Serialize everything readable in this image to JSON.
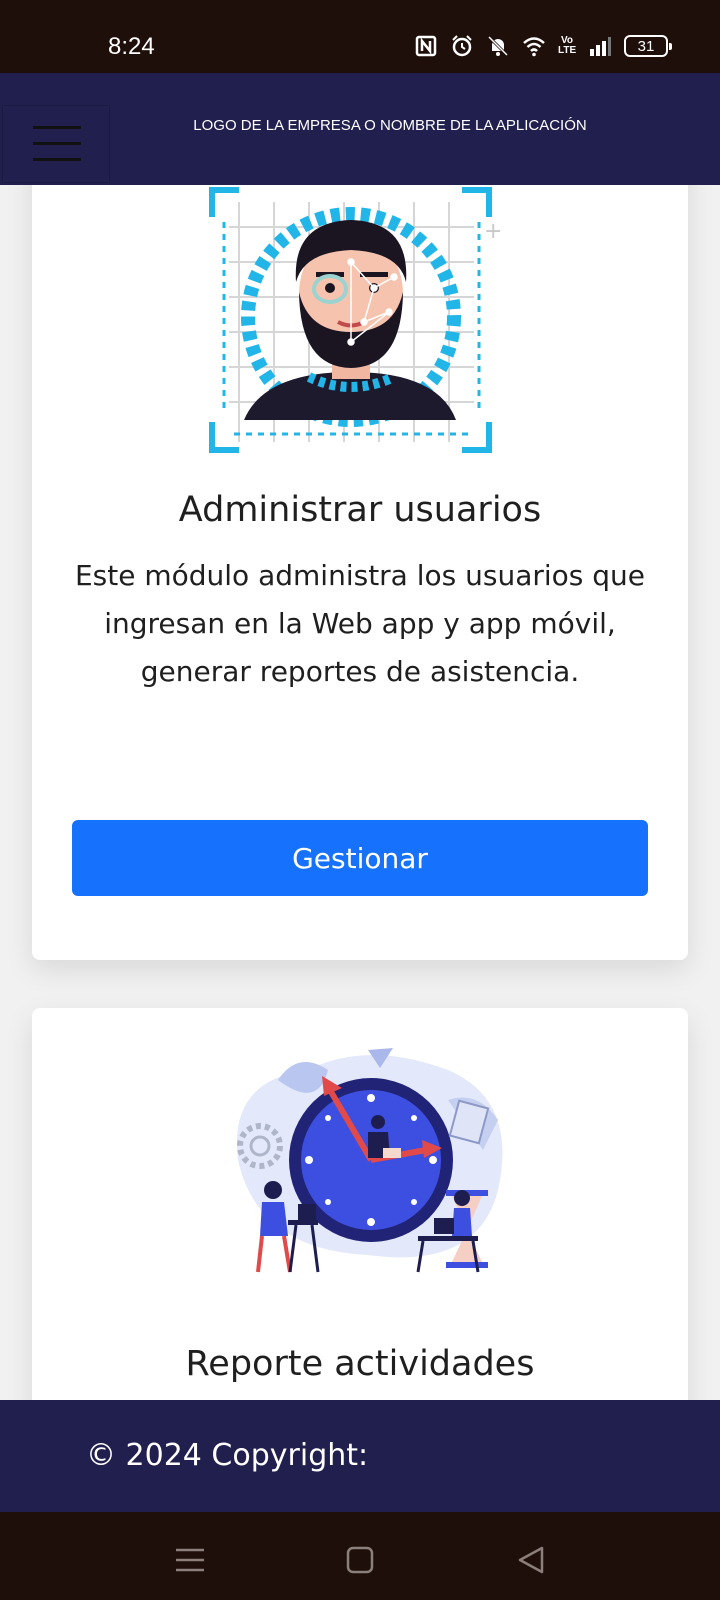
{
  "status_bar": {
    "time": "8:24",
    "icons": [
      "nfc-icon",
      "alarm-icon",
      "mute-icon",
      "wifi-icon",
      "volte-icon",
      "signal-icon"
    ],
    "volte_text": "Vo LTE",
    "battery": "31"
  },
  "header": {
    "title": "LOGO DE LA EMPRESA O NOMBRE DE LA APLICACIÓN",
    "menu_icon": "hamburger-menu-icon"
  },
  "cards": [
    {
      "title": "Administrar usuarios",
      "text": "Este módulo administra los usuarios que ingresan en la Web app y app móvil,  generar reportes de asistencia.",
      "button": "Gestionar"
    },
    {
      "title": "Reporte actividades"
    }
  ],
  "footer": {
    "copyright": "© 2024 Copyright:"
  },
  "nav": {
    "icons": [
      "recents-icon",
      "home-icon",
      "back-icon"
    ]
  },
  "colors": {
    "header_bg": "#211f4d",
    "system_bar_bg": "#1f0f0a",
    "button_bg": "#1672fc",
    "accent_cyan": "#22b5e8",
    "clock_blue": "#3d4fe0"
  }
}
